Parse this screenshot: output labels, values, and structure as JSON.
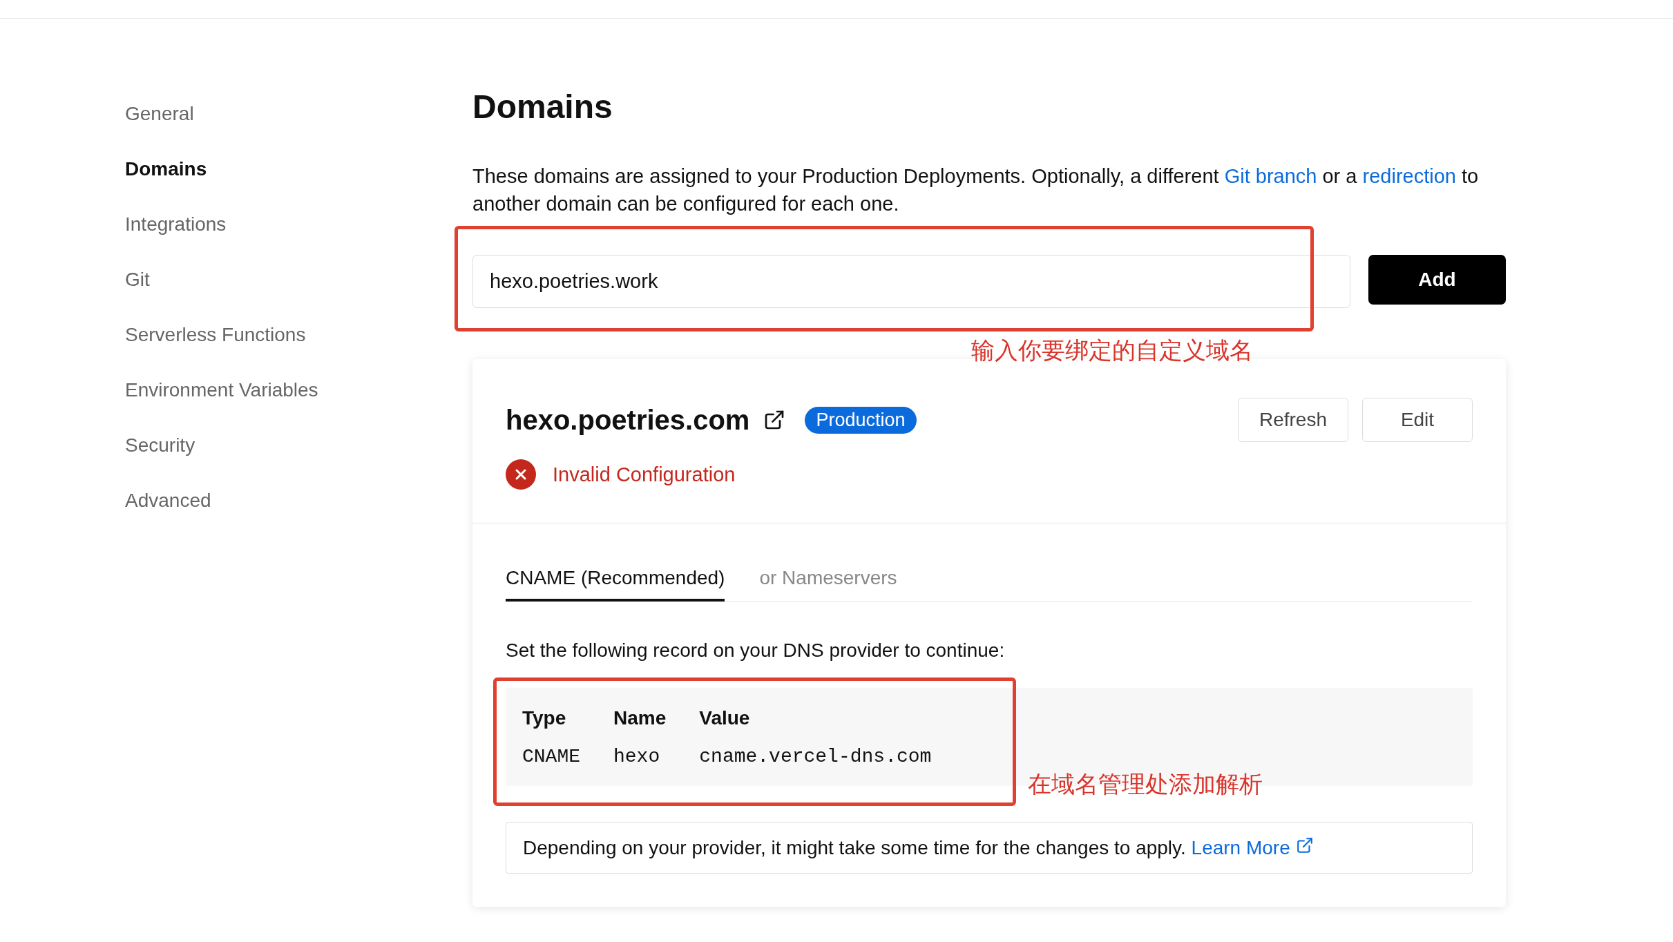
{
  "sidebar": {
    "items": [
      {
        "label": "General",
        "selected": false
      },
      {
        "label": "Domains",
        "selected": true
      },
      {
        "label": "Integrations",
        "selected": false
      },
      {
        "label": "Git",
        "selected": false
      },
      {
        "label": "Serverless Functions",
        "selected": false
      },
      {
        "label": "Environment Variables",
        "selected": false
      },
      {
        "label": "Security",
        "selected": false
      },
      {
        "label": "Advanced",
        "selected": false
      }
    ]
  },
  "title": "Domains",
  "description": [
    {
      "kind": "text",
      "text": "These domains are assigned to your Production Deployments. Optionally, a different "
    },
    {
      "kind": "link",
      "text": "Git branch"
    },
    {
      "kind": "text",
      "text": " or a "
    },
    {
      "kind": "link",
      "text": "redirection"
    },
    {
      "kind": "text",
      "text": " to another domain can be configured for each one."
    }
  ],
  "domain_input": {
    "value": "hexo.poetries.work"
  },
  "add_button": "Add",
  "annotations": [
    "输入你要绑定的自定义域名",
    "在域名管理处添加解析"
  ],
  "domain": {
    "name": "hexo.poetries.com",
    "badge": "Production",
    "buttons": [
      "Refresh",
      "Edit"
    ],
    "status": {
      "kind": "error",
      "text": "Invalid Configuration"
    },
    "tabs": [
      {
        "label": "CNAME (Recommended)",
        "selected": true
      },
      {
        "label": "or Nameservers",
        "selected": false
      }
    ],
    "instruction": "Set the following record on your DNS provider to continue:",
    "table": {
      "columns": [
        "Type",
        "Name",
        "Value"
      ],
      "rows": [
        [
          "CNAME",
          "hexo",
          "cname.vercel-dns.com"
        ]
      ]
    },
    "note": {
      "text": "Depending on your provider, it might take some time for the changes to apply.",
      "link": "Learn More"
    }
  }
}
